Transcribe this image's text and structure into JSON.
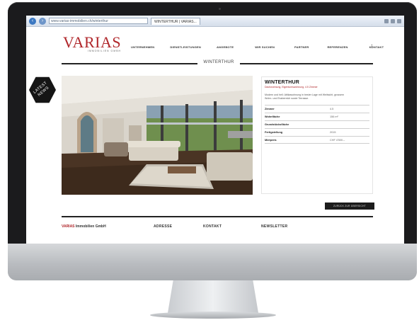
{
  "browser": {
    "url": "www.varias-immobilien.ch/winterthur",
    "tab_label": "WINTERTHUR | VARIAS..."
  },
  "site": {
    "logo": "VARIAS",
    "logo_sub": "IMMOBILIEN GMBH",
    "nav": [
      "UNTERNEHMEN",
      "DIENSTLEISTUNGEN",
      "ANGEBOTE",
      "WIR SUCHEN",
      "PARTNER",
      "REFERENZEN",
      "KONTAKT"
    ],
    "page_title": "WINTERTHUR",
    "latest_news": [
      "LATEST",
      "NEWS"
    ]
  },
  "property": {
    "name": "WINTERTHUR",
    "subtitle": "Dachwohnung, Eigentumswohnung, 4.5 Zimmer",
    "description": "Modern und hell: Attikawohnung in bester Lage mit Weitsicht, grossem Wohn- und Essbereich sowie Terrasse.",
    "details": [
      {
        "label": "Zimmer",
        "value": "4.5"
      },
      {
        "label": "Wohnfläche",
        "value": "156 m²"
      },
      {
        "label": "Grundstücksfläche",
        "value": ""
      },
      {
        "label": "Fertigstellung",
        "value": "2015"
      },
      {
        "label": "Mietpreis",
        "value": "CHF 4'500.–"
      }
    ],
    "back_label": "ZURÜCK ZUR ÜBERSICHT"
  },
  "footer": {
    "brand_red": "VARIAS",
    "brand_rest": "Immobilien GmbH",
    "columns": [
      "ADRESSE",
      "KONTAKT",
      "NEWSLETTER"
    ]
  },
  "colors": {
    "brand": "#b0272b",
    "dark": "#1c1c1c"
  }
}
